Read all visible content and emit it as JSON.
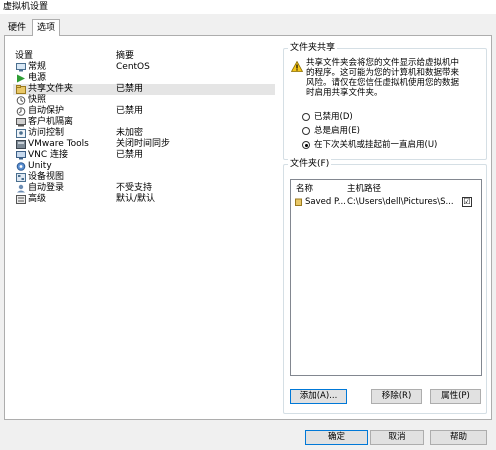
{
  "window": {
    "title": "虚拟机设置"
  },
  "tabs": [
    {
      "label": "硬件"
    },
    {
      "label": "选项"
    }
  ],
  "settings_list": {
    "headers": {
      "setting": "设置",
      "summary": "摘要"
    },
    "items": [
      {
        "name": "常规",
        "summary": "CentOS",
        "icon": "general-icon"
      },
      {
        "name": "电源",
        "summary": "",
        "icon": "power-play-icon"
      },
      {
        "name": "共享文件夹",
        "summary": "已禁用",
        "icon": "shared-folder-icon"
      },
      {
        "name": "快照",
        "summary": "",
        "icon": "snapshot-icon"
      },
      {
        "name": "自动保护",
        "summary": "已禁用",
        "icon": "autoprotect-icon"
      },
      {
        "name": "客户机隔离",
        "summary": "",
        "icon": "guest-isolation-icon"
      },
      {
        "name": "访问控制",
        "summary": "未加密",
        "icon": "access-control-icon"
      },
      {
        "name": "VMware Tools",
        "summary": "关闭时间同步",
        "icon": "vmware-tools-icon"
      },
      {
        "name": "VNC 连接",
        "summary": "已禁用",
        "icon": "vnc-icon"
      },
      {
        "name": "Unity",
        "summary": "",
        "icon": "unity-icon"
      },
      {
        "name": "设备视图",
        "summary": "",
        "icon": "device-view-icon"
      },
      {
        "name": "自动登录",
        "summary": "不受支持",
        "icon": "autologin-icon"
      },
      {
        "name": "高级",
        "summary": "默认/默认",
        "icon": "advanced-icon"
      }
    ]
  },
  "folder_sharing": {
    "title": "文件夹共享",
    "warning": "共享文件夹会将您的文件显示给虚拟机中\n的程序。这可能为您的计算机和数据带来\n风险。请仅在您信任虚拟机使用您的数据\n时启用共享文件夹。",
    "options": [
      {
        "label": "已禁用(D)",
        "selected": false
      },
      {
        "label": "总是启用(E)",
        "selected": false
      },
      {
        "label": "在下次关机或挂起前一直启用(U)",
        "selected": true
      }
    ]
  },
  "folders": {
    "title": "文件夹(F)",
    "columns": {
      "name": "名称",
      "host_path": "主机路径"
    },
    "rows": [
      {
        "name": "Saved P...",
        "host_path": "C:\\Users\\dell\\Pictures\\S...",
        "checked": "☑"
      }
    ],
    "buttons": {
      "add": "添加(A)...",
      "remove": "移除(R)",
      "properties": "属性(P)"
    }
  },
  "dialog_buttons": {
    "ok": "确定",
    "cancel": "取消",
    "help": "帮助"
  }
}
